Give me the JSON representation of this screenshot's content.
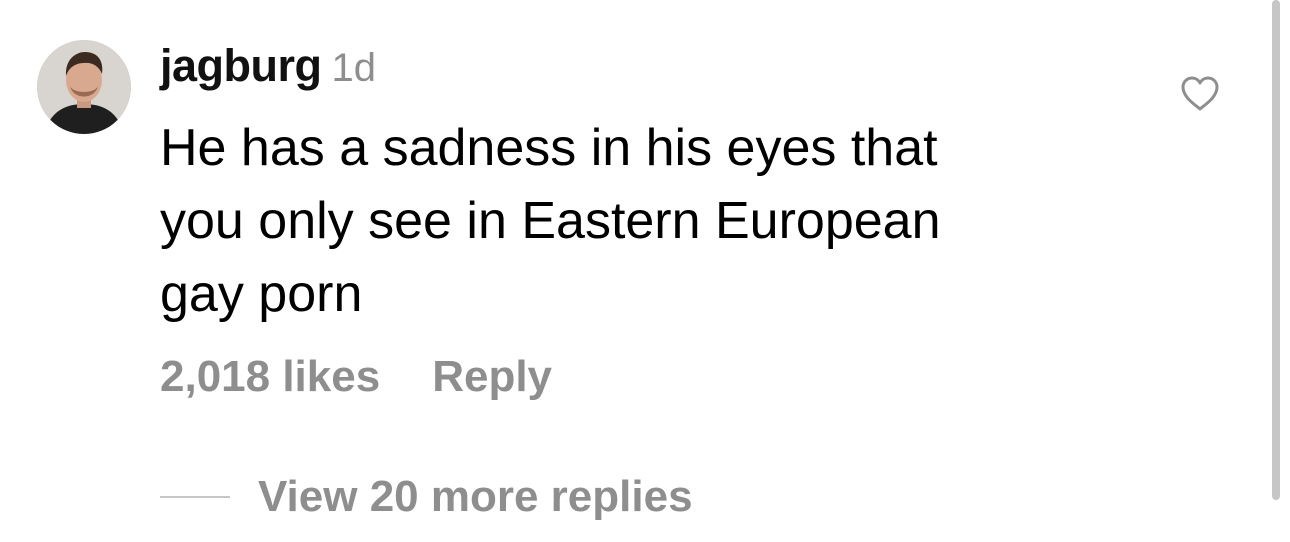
{
  "comment": {
    "username": "jagburg",
    "timestamp": "1d",
    "text_lines": [
      "He has a sadness in his eyes that",
      "you only see in Eastern European",
      "gay porn"
    ],
    "likes_label": "2,018 likes",
    "reply_label": "Reply",
    "like_icon": "heart-outline-icon"
  },
  "replies": {
    "view_more_label": "View 20 more replies"
  },
  "colors": {
    "secondary_text": "#8e8e8e",
    "primary_text": "#000000"
  }
}
